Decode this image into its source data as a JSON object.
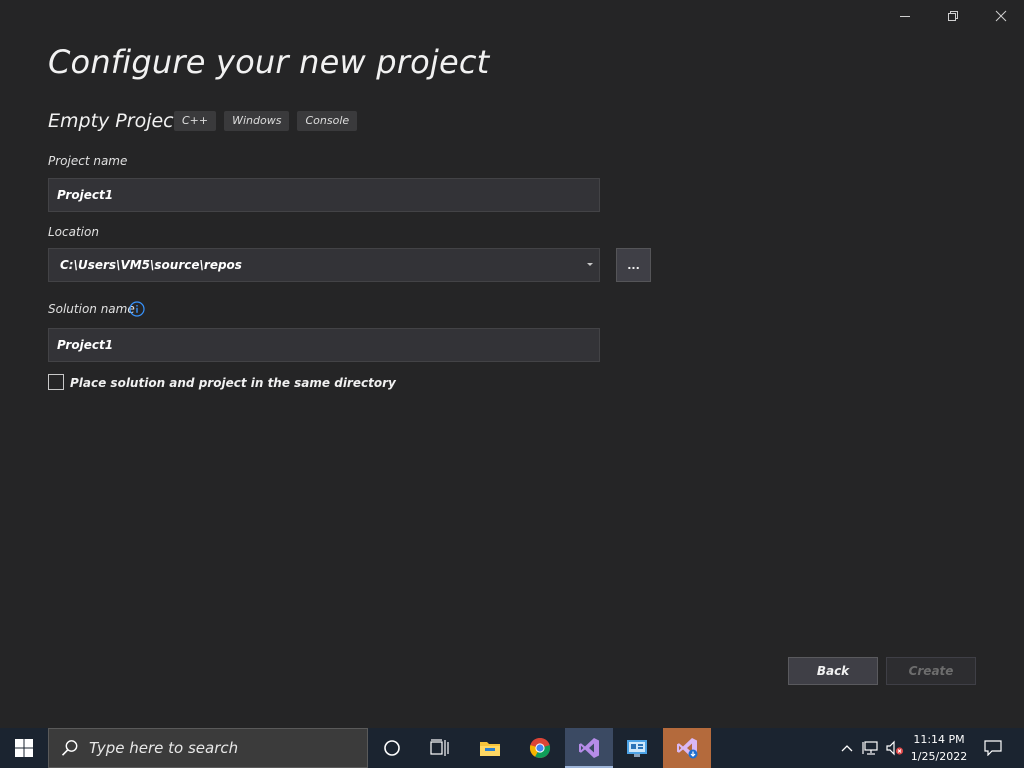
{
  "window": {
    "controls": [
      "minimize-icon",
      "restore-icon",
      "close-icon"
    ]
  },
  "page": {
    "title": "Configure your new project",
    "template_name": "Empty Project",
    "tags": [
      "C++",
      "Windows",
      "Console"
    ]
  },
  "form": {
    "project_name_label": "Project name",
    "project_name_value": "Project1",
    "location_label": "Location",
    "location_value": "C:\\Users\\VM5\\source\\repos",
    "browse_label": "...",
    "solution_name_label": "Solution name",
    "solution_name_value": "Project1",
    "same_dir_label": "Place solution and project in the same directory",
    "same_dir_checked": false
  },
  "buttons": {
    "back": "Back",
    "create": "Create"
  },
  "taskbar": {
    "search_placeholder": "Type here to search",
    "time": "11:14 PM",
    "date": "1/25/2022",
    "apps": [
      "cortana-icon",
      "task-view-icon",
      "file-explorer-icon",
      "chrome-icon",
      "visual-studio-icon",
      "control-panel-icon",
      "visual-studio-installer-icon"
    ]
  },
  "colors": {
    "background": "#252526",
    "input_bg": "#333337",
    "taskbar_bg": "#1b2430",
    "accent": "#3794ff"
  }
}
